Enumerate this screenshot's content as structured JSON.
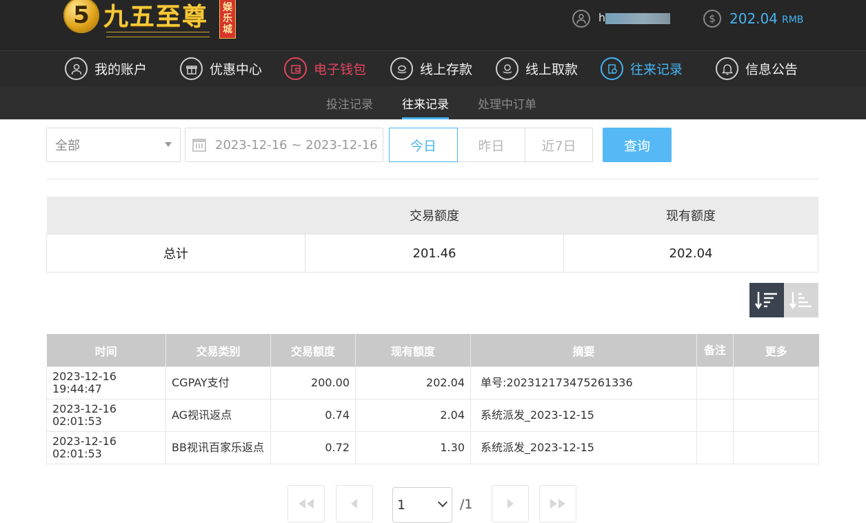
{
  "header": {
    "logo_char": "5",
    "logo_text": "九五至尊",
    "logo_badge": [
      "娱",
      "乐",
      "城"
    ],
    "username": "h",
    "balance": "202.04",
    "balance_unit": "RMB"
  },
  "nav": {
    "items": [
      {
        "label": "我的账户",
        "icon": "user-icon"
      },
      {
        "label": "优惠中心",
        "icon": "gift-icon"
      },
      {
        "label": "电子钱包",
        "icon": "wallet-icon"
      },
      {
        "label": "线上存款",
        "icon": "deposit-icon"
      },
      {
        "label": "线上取款",
        "icon": "withdraw-icon"
      },
      {
        "label": "往来记录",
        "icon": "records-icon"
      },
      {
        "label": "信息公告",
        "icon": "bell-icon"
      }
    ],
    "active": "往来记录"
  },
  "subnav": {
    "items": [
      "投注记录",
      "往来记录",
      "处理中订单"
    ],
    "active": "往来记录"
  },
  "filter": {
    "type_value": "全部",
    "date_range": "2023-12-16 ~ 2023-12-16",
    "ranges": [
      "今日",
      "昨日",
      "近7日"
    ],
    "active_range": "今日",
    "query_label": "查询"
  },
  "summary": {
    "headers": [
      "",
      "交易额度",
      "现有额度"
    ],
    "row": {
      "label": "总计",
      "amount": "201.46",
      "balance": "202.04"
    }
  },
  "records": {
    "headers": [
      "时间",
      "交易类别",
      "交易额度",
      "现有额度",
      "摘要",
      "备注",
      "更多"
    ],
    "rows": [
      {
        "time": "2023-12-16 19:44:47",
        "type": "CGPAY支付",
        "amount": "200.00",
        "balance": "202.04",
        "summary": "单号:202312173475261336",
        "note": "",
        "more": ""
      },
      {
        "time": "2023-12-16 02:01:53",
        "type": "AG视讯返点",
        "amount": "0.74",
        "balance": "2.04",
        "summary": "系统派发_2023-12-15",
        "note": "",
        "more": ""
      },
      {
        "time": "2023-12-16 02:01:53",
        "type": "BB视讯百家乐返点",
        "amount": "0.72",
        "balance": "1.30",
        "summary": "系统派发_2023-12-15",
        "note": "",
        "more": ""
      }
    ]
  },
  "pagination": {
    "current": "1",
    "total": "/1"
  },
  "colors": {
    "accent": "#45b4f2",
    "wallet_red": "#e2465e",
    "header_bg": "#262626",
    "query_btn": "#56b9f5"
  }
}
